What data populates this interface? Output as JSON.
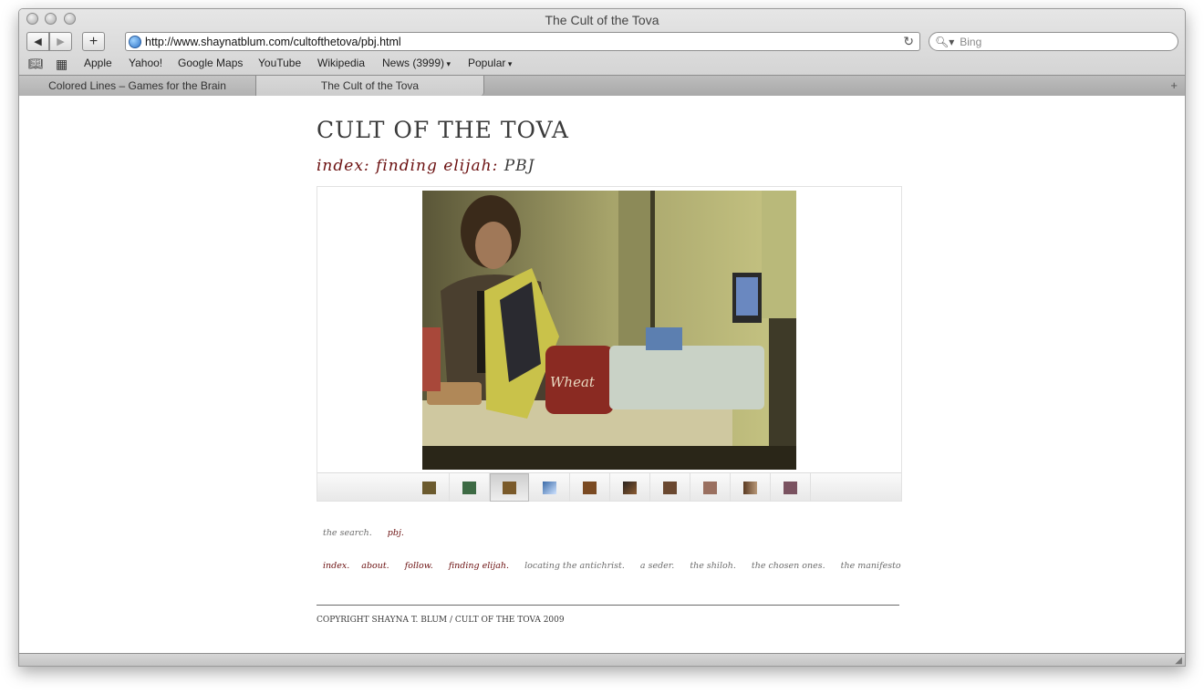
{
  "window": {
    "title": "The Cult of the Tova"
  },
  "toolbar": {
    "back_icon": "back-arrow-icon",
    "forward_icon": "forward-arrow-icon",
    "add_icon": "plus-icon",
    "url": "http://www.shaynatblum.com/cultofthetova/pbj.html",
    "search_placeholder": "Bing"
  },
  "bookmarks": [
    {
      "label": "Apple"
    },
    {
      "label": "Yahoo!"
    },
    {
      "label": "Google Maps"
    },
    {
      "label": "YouTube"
    },
    {
      "label": "Wikipedia"
    },
    {
      "label": "News (3999)"
    },
    {
      "label": "Popular"
    }
  ],
  "tabs": [
    {
      "label": "Colored Lines – Games for the Brain",
      "active": false
    },
    {
      "label": "The Cult of the Tova",
      "active": true
    }
  ],
  "page": {
    "site_title": "CULT OF THE TOVA",
    "breadcrumb": {
      "part1": "index:",
      "part2": "finding elijah:",
      "part3": "PBJ"
    },
    "gallery": {
      "thumbnail_count": 10,
      "selected_index": 3
    },
    "subnav": [
      "the search.",
      "pbj."
    ],
    "mainnav": [
      "index.",
      "about.",
      "follow.",
      "finding elijah.",
      "locating the antichrist.",
      "a seder.",
      "the shiloh.",
      "the chosen ones.",
      "the manifesto"
    ],
    "copyright": "COPYRIGHT SHAYNA T. BLUM / CULT OF THE TOVA 2009"
  }
}
